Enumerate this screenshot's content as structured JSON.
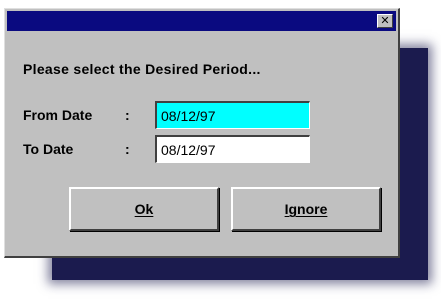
{
  "title_bar": {
    "title": "",
    "close_label": "✕"
  },
  "prompt": "Please select the Desired Period...",
  "fields": {
    "from_label": "From Date",
    "from_colon": ":",
    "from_value": "08/12/97",
    "to_label": "To Date",
    "to_colon": ":",
    "to_value": "08/12/97"
  },
  "buttons": {
    "ok_label": "Ok",
    "ignore_label": "Ignore"
  },
  "colors": {
    "title_bar": "#0a0a80",
    "dialog_face": "#c0c0c0",
    "selected_field": "#00ffff",
    "shadow": "#1b1b4e"
  }
}
